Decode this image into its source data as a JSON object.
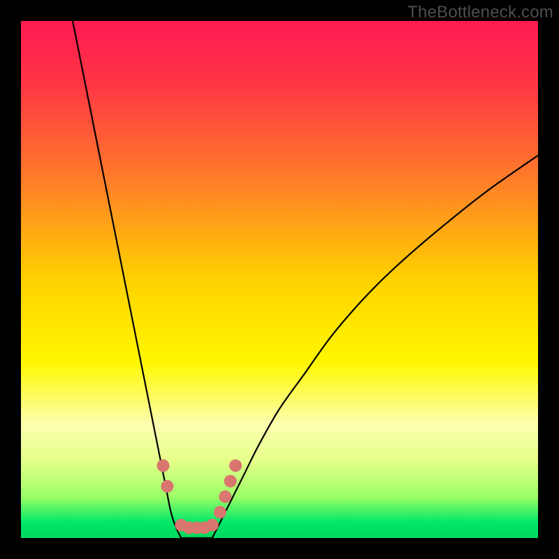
{
  "watermark": "TheBottleneck.com",
  "chart_data": {
    "type": "line",
    "title": "",
    "xlabel": "",
    "ylabel": "",
    "xlim": [
      0,
      100
    ],
    "ylim": [
      0,
      100
    ],
    "gradient_stops": [
      {
        "offset": 0.0,
        "color": "#ff1a52"
      },
      {
        "offset": 0.12,
        "color": "#ff3545"
      },
      {
        "offset": 0.3,
        "color": "#ff7a2a"
      },
      {
        "offset": 0.5,
        "color": "#ffd200"
      },
      {
        "offset": 0.66,
        "color": "#fff700"
      },
      {
        "offset": 0.78,
        "color": "#fcffb0"
      },
      {
        "offset": 0.85,
        "color": "#e6ff8a"
      },
      {
        "offset": 0.92,
        "color": "#9cff66"
      },
      {
        "offset": 0.97,
        "color": "#00e86a"
      },
      {
        "offset": 1.0,
        "color": "#00d85e"
      }
    ],
    "series": [
      {
        "name": "left-branch",
        "x": [
          10,
          12,
          14,
          16,
          18,
          20,
          22,
          24,
          26,
          28,
          29,
          30,
          31
        ],
        "y": [
          100,
          90,
          80,
          70,
          60,
          50,
          40,
          30,
          20,
          10,
          5,
          2,
          0
        ]
      },
      {
        "name": "right-branch",
        "x": [
          37,
          38,
          40,
          43,
          46,
          50,
          55,
          60,
          66,
          72,
          80,
          90,
          100
        ],
        "y": [
          0,
          2,
          6,
          12,
          18,
          25,
          32,
          39,
          46,
          52,
          59,
          67,
          74
        ]
      },
      {
        "name": "valley-floor",
        "x": [
          31,
          32,
          33,
          34,
          35,
          36,
          37
        ],
        "y": [
          0,
          0,
          0,
          0,
          0,
          0,
          0
        ]
      }
    ],
    "marker_series": [
      {
        "name": "highlight-dots",
        "color": "#d9766e",
        "points": [
          {
            "x": 27.5,
            "y": 14
          },
          {
            "x": 28.3,
            "y": 10
          },
          {
            "x": 31.0,
            "y": 2.5
          },
          {
            "x": 32.5,
            "y": 2.0
          },
          {
            "x": 34.0,
            "y": 2.0
          },
          {
            "x": 35.5,
            "y": 2.0
          },
          {
            "x": 37.0,
            "y": 2.5
          },
          {
            "x": 38.5,
            "y": 5
          },
          {
            "x": 39.5,
            "y": 8
          },
          {
            "x": 40.5,
            "y": 11
          },
          {
            "x": 41.5,
            "y": 14
          }
        ]
      }
    ]
  }
}
